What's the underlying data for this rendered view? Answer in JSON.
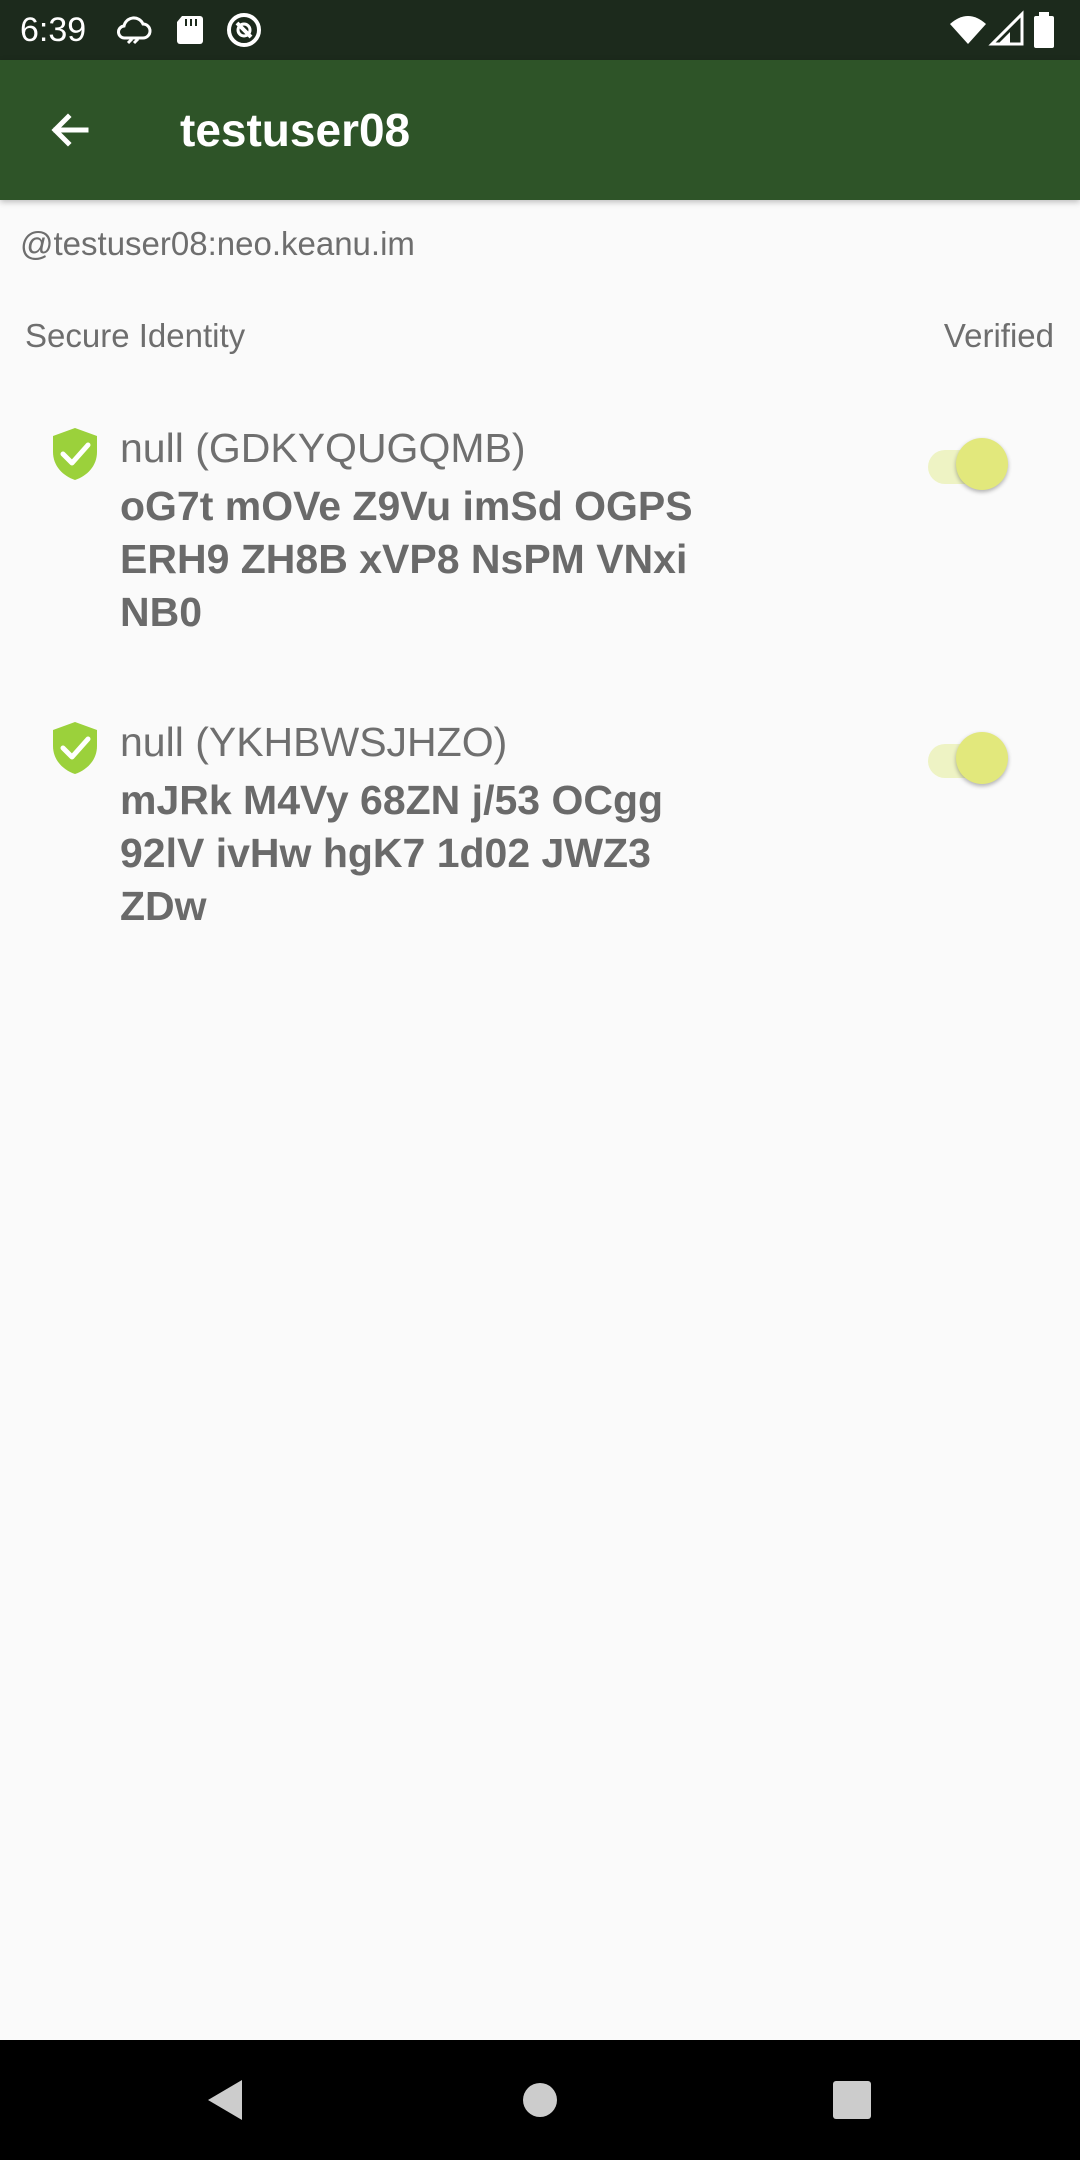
{
  "status_bar": {
    "time": "6:39",
    "left_icons": [
      "cloud-sync-icon",
      "sd-card-icon",
      "vpn-icon"
    ],
    "right_icons": [
      "wifi-icon",
      "signal-icon",
      "battery-icon"
    ]
  },
  "app_bar": {
    "back_icon": "arrow-back-icon",
    "title": "testuser08"
  },
  "user": {
    "id": "@testuser08:neo.keanu.im"
  },
  "section": {
    "left_label": "Secure Identity",
    "right_label": "Verified"
  },
  "devices": [
    {
      "name": "null (GDKYQUGQMB)",
      "fingerprint": "oG7t mOVe Z9Vu imSd OGPS ERH9 ZH8B xVP8 NsPM VNxi NB0",
      "verified": true,
      "icon": "verified-shield-icon"
    },
    {
      "name": "null (YKHBWSJHZO)",
      "fingerprint": "mJRk M4Vy 68ZN j/53 OCgg 92lV ivHw hgK7 1d02 JWZ3 ZDw",
      "verified": true,
      "icon": "verified-shield-icon"
    }
  ],
  "colors": {
    "status_bar": "#1c2a1c",
    "app_bar": "#2e5428",
    "shield": "#9bd13b",
    "toggle_thumb": "#e2e87c",
    "toggle_track": "#eef3c4",
    "nav_bar": "#000000"
  },
  "nav_bar": {
    "buttons": [
      "back-triangle-icon",
      "home-circle-icon",
      "recents-square-icon"
    ]
  }
}
